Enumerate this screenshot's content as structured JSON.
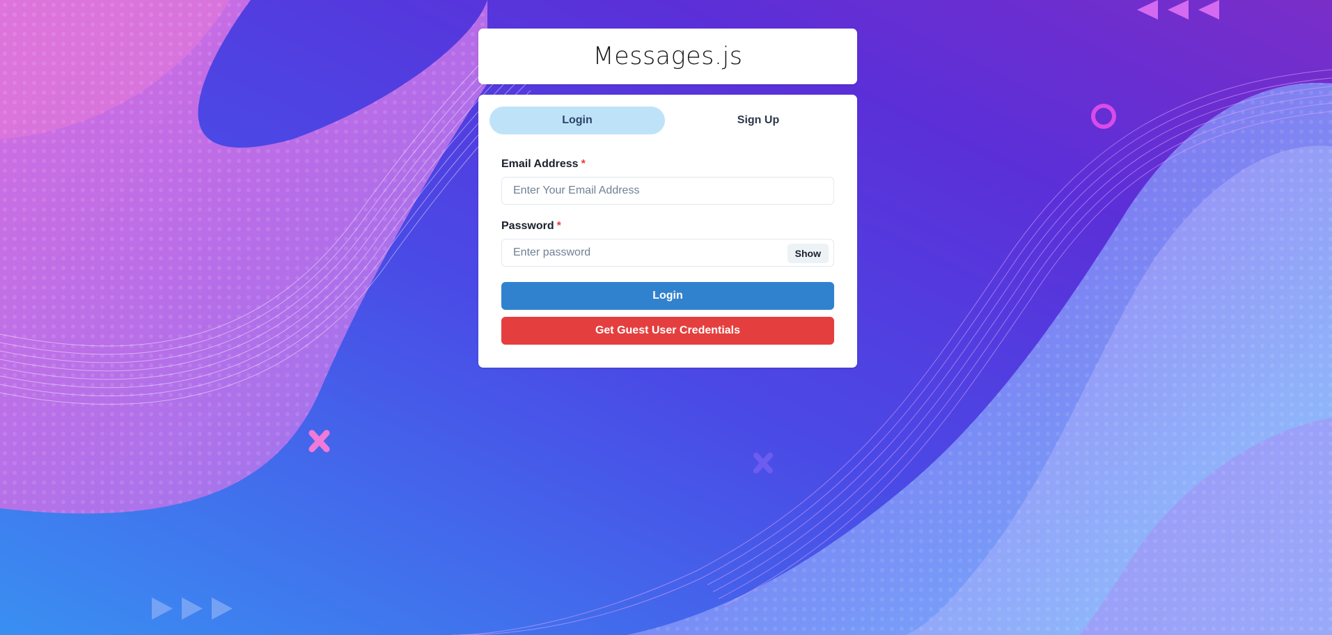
{
  "app": {
    "title": "Messages.js"
  },
  "tabs": [
    {
      "label": "Login",
      "active": true
    },
    {
      "label": "Sign Up",
      "active": false
    }
  ],
  "form": {
    "email": {
      "label": "Email Address",
      "required_mark": "*",
      "placeholder": "Enter Your Email Address",
      "value": ""
    },
    "password": {
      "label": "Password",
      "required_mark": "*",
      "placeholder": "Enter password",
      "value": "",
      "toggle_label": "Show"
    },
    "login_button": "Login",
    "guest_button": "Get Guest User Credentials"
  },
  "colors": {
    "tab_active_bg": "#bee3f8",
    "primary": "#3182ce",
    "danger": "#e53e3e",
    "required": "#e53e3e"
  }
}
